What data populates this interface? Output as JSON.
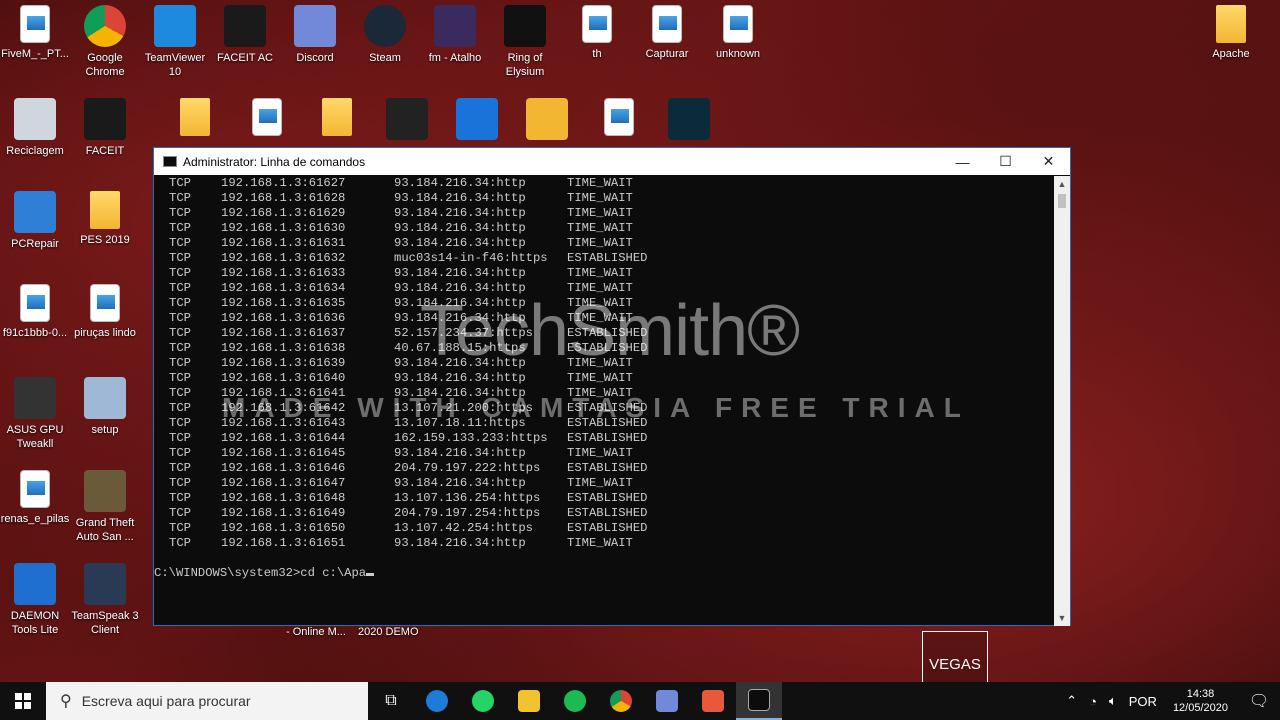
{
  "desktop": {
    "icons": [
      {
        "label": "FiveM_-_PT...",
        "name": "fivem-shortcut"
      },
      {
        "label": "Google Chrome",
        "name": "google-chrome"
      },
      {
        "label": "TeamViewer 10",
        "name": "teamviewer"
      },
      {
        "label": "FACEIT AC",
        "name": "faceit-ac"
      },
      {
        "label": "Discord",
        "name": "discord"
      },
      {
        "label": "Steam",
        "name": "steam"
      },
      {
        "label": "fm - Atalho",
        "name": "fm-atalho"
      },
      {
        "label": "Ring of Elysium",
        "name": "ring-of-elysium"
      },
      {
        "label": "th",
        "name": "th"
      },
      {
        "label": "Capturar",
        "name": "capturar"
      },
      {
        "label": "unknown",
        "name": "unknown"
      },
      {
        "label": "Apache",
        "name": "apache"
      },
      {
        "label": "Reciclagem",
        "name": "recycle-bin"
      },
      {
        "label": "FACEIT",
        "name": "faceit"
      },
      {
        "label": "PCRepair",
        "name": "pcrepair"
      },
      {
        "label": "PES 2019",
        "name": "pes-2019"
      },
      {
        "label": "f91c1bbb-0...",
        "name": "f91c1bbb"
      },
      {
        "label": "piruças lindo",
        "name": "pirucas-lindo"
      },
      {
        "label": "ASUS GPU Tweakll",
        "name": "asus-gpu-tweak"
      },
      {
        "label": "setup",
        "name": "setup"
      },
      {
        "label": "renas_e_pilas",
        "name": "renas-e-pilas"
      },
      {
        "label": "Grand Theft Auto San ...",
        "name": "gta-san-andreas"
      },
      {
        "label": "DAEMON Tools Lite",
        "name": "daemon-tools"
      },
      {
        "label": "TeamSpeak 3 Client",
        "name": "teamspeak"
      }
    ],
    "under_labels": [
      "- Online M...",
      "2020 DEMO"
    ]
  },
  "window": {
    "title": "Administrator: Linha de comandos",
    "minimize": "—",
    "maximize": "☐",
    "close": "✕"
  },
  "console": {
    "rows": [
      [
        "TCP",
        "192.168.1.3:61627",
        "93.184.216.34:http",
        "TIME_WAIT"
      ],
      [
        "TCP",
        "192.168.1.3:61628",
        "93.184.216.34:http",
        "TIME_WAIT"
      ],
      [
        "TCP",
        "192.168.1.3:61629",
        "93.184.216.34:http",
        "TIME_WAIT"
      ],
      [
        "TCP",
        "192.168.1.3:61630",
        "93.184.216.34:http",
        "TIME_WAIT"
      ],
      [
        "TCP",
        "192.168.1.3:61631",
        "93.184.216.34:http",
        "TIME_WAIT"
      ],
      [
        "TCP",
        "192.168.1.3:61632",
        "muc03s14-in-f46:https",
        "ESTABLISHED"
      ],
      [
        "TCP",
        "192.168.1.3:61633",
        "93.184.216.34:http",
        "TIME_WAIT"
      ],
      [
        "TCP",
        "192.168.1.3:61634",
        "93.184.216.34:http",
        "TIME_WAIT"
      ],
      [
        "TCP",
        "192.168.1.3:61635",
        "93.184.216.34:http",
        "TIME_WAIT"
      ],
      [
        "TCP",
        "192.168.1.3:61636",
        "93.184.216.34:http",
        "TIME_WAIT"
      ],
      [
        "TCP",
        "192.168.1.3:61637",
        "52.157.234.37:https",
        "ESTABLISHED"
      ],
      [
        "TCP",
        "192.168.1.3:61638",
        "40.67.188.15:https",
        "ESTABLISHED"
      ],
      [
        "TCP",
        "192.168.1.3:61639",
        "93.184.216.34:http",
        "TIME_WAIT"
      ],
      [
        "TCP",
        "192.168.1.3:61640",
        "93.184.216.34:http",
        "TIME_WAIT"
      ],
      [
        "TCP",
        "192.168.1.3:61641",
        "93.184.216.34:http",
        "TIME_WAIT"
      ],
      [
        "TCP",
        "192.168.1.3:61642",
        "13.107.21.200:https",
        "ESTABLISHED"
      ],
      [
        "TCP",
        "192.168.1.3:61643",
        "13.107.18.11:https",
        "ESTABLISHED"
      ],
      [
        "TCP",
        "192.168.1.3:61644",
        "162.159.133.233:https",
        "ESTABLISHED"
      ],
      [
        "TCP",
        "192.168.1.3:61645",
        "93.184.216.34:http",
        "TIME_WAIT"
      ],
      [
        "TCP",
        "192.168.1.3:61646",
        "204.79.197.222:https",
        "ESTABLISHED"
      ],
      [
        "TCP",
        "192.168.1.3:61647",
        "93.184.216.34:http",
        "TIME_WAIT"
      ],
      [
        "TCP",
        "192.168.1.3:61648",
        "13.107.136.254:https",
        "ESTABLISHED"
      ],
      [
        "TCP",
        "192.168.1.3:61649",
        "204.79.197.254:https",
        "ESTABLISHED"
      ],
      [
        "TCP",
        "192.168.1.3:61650",
        "13.107.42.254:https",
        "ESTABLISHED"
      ],
      [
        "TCP",
        "192.168.1.3:61651",
        "93.184.216.34:http",
        "TIME_WAIT"
      ]
    ],
    "prompt": "C:\\WINDOWS\\system32>cd c:\\Apa"
  },
  "watermark": {
    "brand": "TechSmith®",
    "trial": "MADE WITH CAMTASIA FREE TRIAL"
  },
  "vegas_label": "VEGAS",
  "taskbar": {
    "search_placeholder": "Escreva aqui para procurar",
    "apps": [
      "task-view",
      "edge",
      "whatsapp",
      "file-explorer",
      "spotify",
      "chrome",
      "discord",
      "camtasia",
      "cmd"
    ],
    "language": "POR",
    "time": "14:38",
    "date": "12/05/2020"
  }
}
